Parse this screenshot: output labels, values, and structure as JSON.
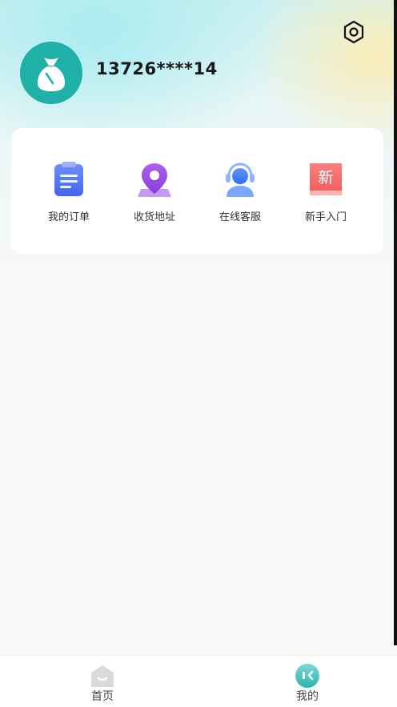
{
  "profile": {
    "phone": "13726****14",
    "avatar_icon": "money-bag-icon",
    "avatar_color": "#1fb0a8"
  },
  "header": {
    "settings_icon": "settings-hexagon-icon"
  },
  "menu": {
    "items": [
      {
        "label": "我的订单",
        "icon": "clipboard-icon",
        "color": "#4a6cf0"
      },
      {
        "label": "收货地址",
        "icon": "location-pin-icon",
        "color": "#9b4de6"
      },
      {
        "label": "在线客服",
        "icon": "headset-service-icon",
        "color": "#3d7cf2"
      },
      {
        "label": "新手入门",
        "icon": "new-badge-icon",
        "color": "#f26a6a",
        "icon_text": "新"
      }
    ]
  },
  "tabbar": {
    "items": [
      {
        "label": "首页",
        "icon": "home-icon",
        "active": false
      },
      {
        "label": "我的",
        "icon": "profile-face-icon",
        "active": true
      }
    ]
  }
}
